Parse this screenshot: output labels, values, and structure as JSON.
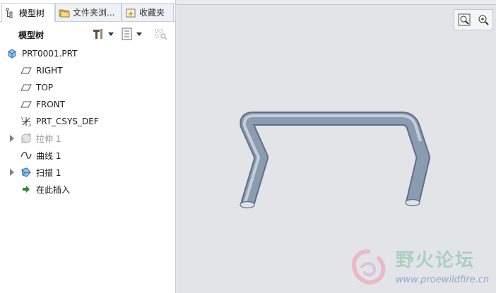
{
  "tabs": [
    {
      "label": "模型树",
      "icon": "model-tree-icon",
      "active": true
    },
    {
      "label": "文件夹浏...",
      "icon": "folder-icon",
      "active": false
    },
    {
      "label": "收藏夹",
      "icon": "favorites-icon",
      "active": false
    }
  ],
  "toolbar": {
    "title": "模型树"
  },
  "tree": {
    "root": {
      "label": "PRT0001.PRT",
      "icon": "part-icon"
    },
    "items": [
      {
        "label": "RIGHT",
        "icon": "datum-plane-icon"
      },
      {
        "label": "TOP",
        "icon": "datum-plane-icon"
      },
      {
        "label": "FRONT",
        "icon": "datum-plane-icon"
      },
      {
        "label": "PRT_CSYS_DEF",
        "icon": "csys-icon"
      },
      {
        "label": "拉伸 1",
        "icon": "extrude-icon",
        "expandable": true,
        "dimmed": true
      },
      {
        "label": "曲线 1",
        "icon": "curve-icon"
      },
      {
        "label": "扫描 1",
        "icon": "sweep-icon",
        "expandable": true
      },
      {
        "label": "在此插入",
        "icon": "insert-here-icon"
      }
    ]
  },
  "watermark": {
    "title": "野火论坛",
    "url": "www.proewildfire.cn"
  },
  "colors": {
    "background": "#e2e4e8",
    "model": "#8a9aaf",
    "panel": "#ffffff"
  }
}
